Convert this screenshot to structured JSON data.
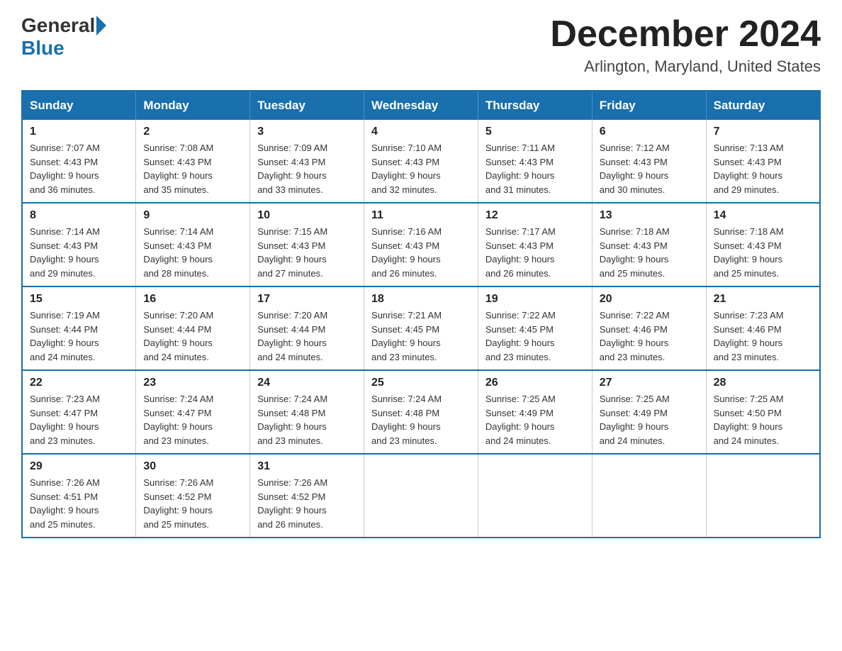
{
  "logo": {
    "general": "General",
    "blue": "Blue"
  },
  "title": "December 2024",
  "location": "Arlington, Maryland, United States",
  "weekdays": [
    "Sunday",
    "Monday",
    "Tuesday",
    "Wednesday",
    "Thursday",
    "Friday",
    "Saturday"
  ],
  "weeks": [
    [
      {
        "day": "1",
        "sunrise": "7:07 AM",
        "sunset": "4:43 PM",
        "daylight": "9 hours and 36 minutes."
      },
      {
        "day": "2",
        "sunrise": "7:08 AM",
        "sunset": "4:43 PM",
        "daylight": "9 hours and 35 minutes."
      },
      {
        "day": "3",
        "sunrise": "7:09 AM",
        "sunset": "4:43 PM",
        "daylight": "9 hours and 33 minutes."
      },
      {
        "day": "4",
        "sunrise": "7:10 AM",
        "sunset": "4:43 PM",
        "daylight": "9 hours and 32 minutes."
      },
      {
        "day": "5",
        "sunrise": "7:11 AM",
        "sunset": "4:43 PM",
        "daylight": "9 hours and 31 minutes."
      },
      {
        "day": "6",
        "sunrise": "7:12 AM",
        "sunset": "4:43 PM",
        "daylight": "9 hours and 30 minutes."
      },
      {
        "day": "7",
        "sunrise": "7:13 AM",
        "sunset": "4:43 PM",
        "daylight": "9 hours and 29 minutes."
      }
    ],
    [
      {
        "day": "8",
        "sunrise": "7:14 AM",
        "sunset": "4:43 PM",
        "daylight": "9 hours and 29 minutes."
      },
      {
        "day": "9",
        "sunrise": "7:14 AM",
        "sunset": "4:43 PM",
        "daylight": "9 hours and 28 minutes."
      },
      {
        "day": "10",
        "sunrise": "7:15 AM",
        "sunset": "4:43 PM",
        "daylight": "9 hours and 27 minutes."
      },
      {
        "day": "11",
        "sunrise": "7:16 AM",
        "sunset": "4:43 PM",
        "daylight": "9 hours and 26 minutes."
      },
      {
        "day": "12",
        "sunrise": "7:17 AM",
        "sunset": "4:43 PM",
        "daylight": "9 hours and 26 minutes."
      },
      {
        "day": "13",
        "sunrise": "7:18 AM",
        "sunset": "4:43 PM",
        "daylight": "9 hours and 25 minutes."
      },
      {
        "day": "14",
        "sunrise": "7:18 AM",
        "sunset": "4:43 PM",
        "daylight": "9 hours and 25 minutes."
      }
    ],
    [
      {
        "day": "15",
        "sunrise": "7:19 AM",
        "sunset": "4:44 PM",
        "daylight": "9 hours and 24 minutes."
      },
      {
        "day": "16",
        "sunrise": "7:20 AM",
        "sunset": "4:44 PM",
        "daylight": "9 hours and 24 minutes."
      },
      {
        "day": "17",
        "sunrise": "7:20 AM",
        "sunset": "4:44 PM",
        "daylight": "9 hours and 24 minutes."
      },
      {
        "day": "18",
        "sunrise": "7:21 AM",
        "sunset": "4:45 PM",
        "daylight": "9 hours and 23 minutes."
      },
      {
        "day": "19",
        "sunrise": "7:22 AM",
        "sunset": "4:45 PM",
        "daylight": "9 hours and 23 minutes."
      },
      {
        "day": "20",
        "sunrise": "7:22 AM",
        "sunset": "4:46 PM",
        "daylight": "9 hours and 23 minutes."
      },
      {
        "day": "21",
        "sunrise": "7:23 AM",
        "sunset": "4:46 PM",
        "daylight": "9 hours and 23 minutes."
      }
    ],
    [
      {
        "day": "22",
        "sunrise": "7:23 AM",
        "sunset": "4:47 PM",
        "daylight": "9 hours and 23 minutes."
      },
      {
        "day": "23",
        "sunrise": "7:24 AM",
        "sunset": "4:47 PM",
        "daylight": "9 hours and 23 minutes."
      },
      {
        "day": "24",
        "sunrise": "7:24 AM",
        "sunset": "4:48 PM",
        "daylight": "9 hours and 23 minutes."
      },
      {
        "day": "25",
        "sunrise": "7:24 AM",
        "sunset": "4:48 PM",
        "daylight": "9 hours and 23 minutes."
      },
      {
        "day": "26",
        "sunrise": "7:25 AM",
        "sunset": "4:49 PM",
        "daylight": "9 hours and 24 minutes."
      },
      {
        "day": "27",
        "sunrise": "7:25 AM",
        "sunset": "4:49 PM",
        "daylight": "9 hours and 24 minutes."
      },
      {
        "day": "28",
        "sunrise": "7:25 AM",
        "sunset": "4:50 PM",
        "daylight": "9 hours and 24 minutes."
      }
    ],
    [
      {
        "day": "29",
        "sunrise": "7:26 AM",
        "sunset": "4:51 PM",
        "daylight": "9 hours and 25 minutes."
      },
      {
        "day": "30",
        "sunrise": "7:26 AM",
        "sunset": "4:52 PM",
        "daylight": "9 hours and 25 minutes."
      },
      {
        "day": "31",
        "sunrise": "7:26 AM",
        "sunset": "4:52 PM",
        "daylight": "9 hours and 26 minutes."
      },
      null,
      null,
      null,
      null
    ]
  ],
  "labels": {
    "sunrise": "Sunrise:",
    "sunset": "Sunset:",
    "daylight": "Daylight:"
  }
}
